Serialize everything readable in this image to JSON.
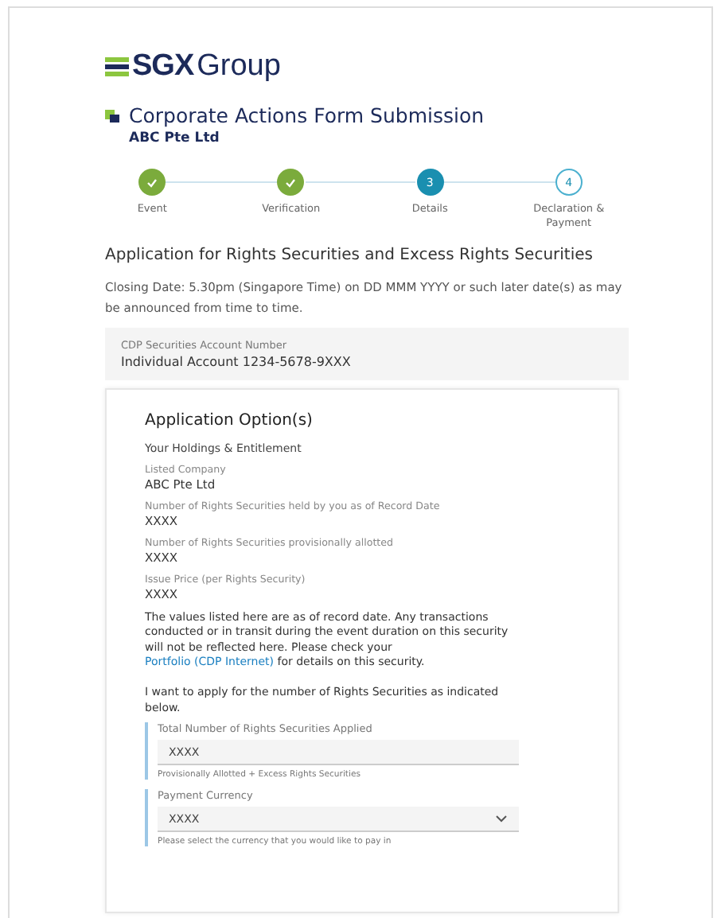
{
  "logo": {
    "brand": "SGX",
    "suffix": "Group"
  },
  "header": {
    "title": "Corporate Actions Form Submission",
    "company": "ABC Pte Ltd"
  },
  "steps": [
    {
      "label": "Event",
      "kind": "done"
    },
    {
      "label": "Verification",
      "kind": "done"
    },
    {
      "label": "Details",
      "kind": "current",
      "number": "3"
    },
    {
      "label": "Declaration & Payment",
      "kind": "todo",
      "number": "4"
    }
  ],
  "heading": "Application for Rights Securities and Excess Rights Securities",
  "closing_note": "Closing Date: 5.30pm (Singapore Time) on DD MMM YYYY or such later date(s) as may be announced from time to time.",
  "account": {
    "label": "CDP Securities Account Number",
    "value": "Individual Account 1234-5678-9XXX"
  },
  "card": {
    "title": "Application Option(s)",
    "subtitle": "Your Holdings & Entitlement",
    "fields": [
      {
        "label": "Listed Company",
        "value": "ABC Pte Ltd"
      },
      {
        "label": "Number of Rights Securities held by you as of Record Date",
        "value": "XXXX"
      },
      {
        "label": "Number of Rights Securities provisionally allotted",
        "value": "XXXX"
      },
      {
        "label": "Issue Price (per Rights Security)",
        "value": "XXXX"
      }
    ],
    "disclaimer": {
      "before": "The values listed here are as of record date. Any transactions conducted or in transit during the event duration on this security will not be reflected here. Please check your",
      "link": "Portfolio (CDP Internet)",
      "after": "for details on this security."
    },
    "instruction": "I want to apply for the number of Rights Securities as indicated below.",
    "inputs": [
      {
        "kind": "text",
        "label": "Total Number of Rights Securities Applied",
        "value": "XXXX",
        "hint": "Provisionally Allotted + Excess Rights Securities"
      },
      {
        "kind": "select",
        "label": "Payment Currency",
        "value": "XXXX",
        "hint": "Please select the currency that you would like to pay in"
      }
    ]
  }
}
